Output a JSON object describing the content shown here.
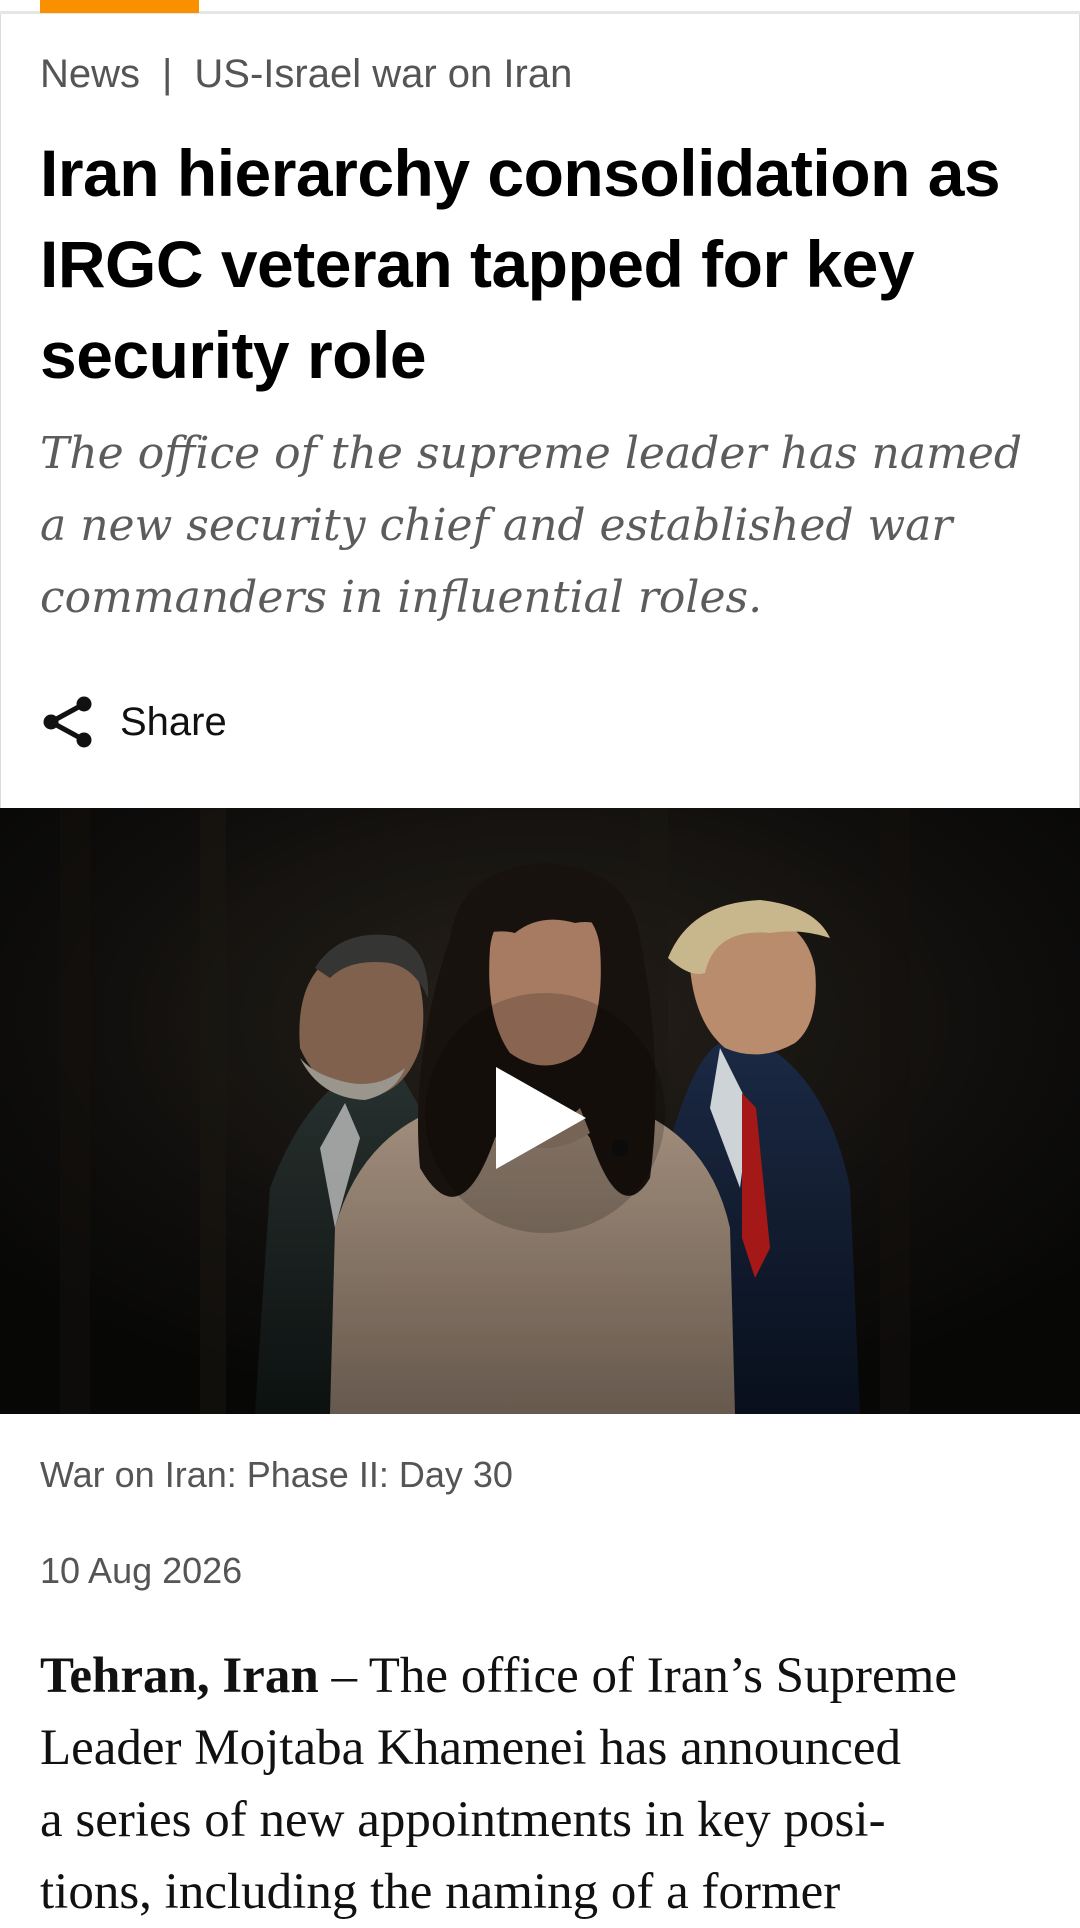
{
  "breadcrumb": {
    "section": "News",
    "separator": "|",
    "topic": "US-Israel war on Iran"
  },
  "article": {
    "headline": "Iran hierarchy consolidation as IRGC veteran tapped for key security role",
    "standfirst": "The office of the supreme leader has named a new security chief and established war commanders in influential roles.",
    "share_label": "Share",
    "episode_label": "War on Iran: Phase II: Day 30",
    "date": "10 Aug 2026",
    "lead_place": "Tehran, Iran",
    "lead_dash": " – ",
    "lead_body_lines": [
      "The office of Iran’s Supreme",
      "Leader Mojtaba Khamenei has announced",
      "a series of new appointments in key posi-",
      "tions, including the naming of a former"
    ]
  },
  "icons": {
    "share": "share-icon",
    "play": "play-icon"
  },
  "colors": {
    "accent": "#fa9000",
    "muted_text": "#555555",
    "standfirst_text": "#5c5c5c",
    "media_background": "#0c0c0b"
  }
}
